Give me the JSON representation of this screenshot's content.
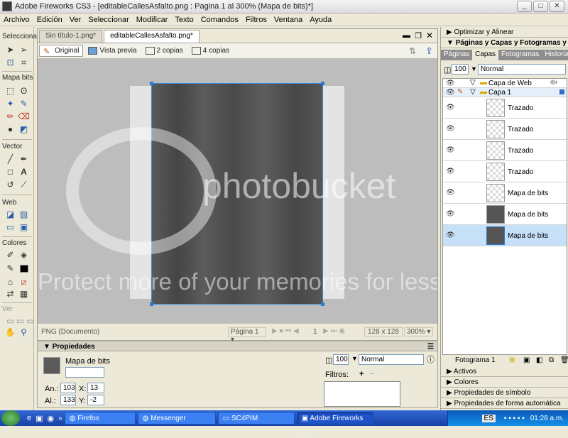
{
  "window": {
    "title": "Adobe Fireworks CS3 - [editableCallesAsfalto.png : Pagina 1 al 300% (Mapa de bits)*]"
  },
  "menu": [
    "Archivo",
    "Edición",
    "Ver",
    "Seleccionar",
    "Modificar",
    "Texto",
    "Comandos",
    "Filtros",
    "Ventana",
    "Ayuda"
  ],
  "tools": {
    "sections": [
      "Seleccionar",
      "Mapa bits",
      "Vector",
      "Web",
      "Colores",
      "Ver"
    ]
  },
  "doc": {
    "tabs": [
      "Sin título-1.png*",
      "editableCallesAsfalto.png*"
    ],
    "views": [
      "Original",
      "Vista previa",
      "2 copias",
      "4 copias"
    ],
    "status": {
      "type": "PNG (Documento)",
      "page": "Página 1",
      "frame": "1",
      "size": "128 x 128",
      "zoom": "300%"
    }
  },
  "properties": {
    "title": "Propiedades",
    "object": "Mapa de bits",
    "name_value": "",
    "w_label": "An.:",
    "w": "103",
    "h_label": "Al.:",
    "h": "133",
    "x_label": "X:",
    "x": "13",
    "y_label": "Y:",
    "y": "-2",
    "opacity": "100",
    "blend": "Normal",
    "filters_label": "Filtros:"
  },
  "rpanel": {
    "optimize": "Optimizar y Alinear",
    "pages_title": "Páginas y Capas y Fotogramas y ...",
    "tabs": [
      "Páginas",
      "Capas",
      "Fotogramas",
      "Historial"
    ],
    "opacity": "100",
    "blend": "Normal",
    "layers": [
      {
        "name": "Capa de Web",
        "type": "folder"
      },
      {
        "name": "Capa 1",
        "type": "folder"
      },
      {
        "name": "Trazado",
        "type": "obj"
      },
      {
        "name": "Trazado",
        "type": "obj"
      },
      {
        "name": "Trazado",
        "type": "obj"
      },
      {
        "name": "Trazado",
        "type": "obj"
      },
      {
        "name": "Mapa de bits",
        "type": "obj"
      },
      {
        "name": "Mapa de bits",
        "type": "obj"
      },
      {
        "name": "Mapa de bits",
        "type": "obj",
        "selected": true
      }
    ],
    "frame": "Fotograma 1",
    "collapsed": [
      "Activos",
      "Colores",
      "Propiedades de símbolo",
      "Propiedades de forma automática"
    ]
  },
  "taskbar": {
    "items": [
      "Firefox",
      "Messenger",
      "SC4PIM",
      "Adobe Fireworks ..."
    ],
    "lang": "ES",
    "time": "01:28 a.m."
  },
  "watermark": {
    "brand": "photobucket",
    "tagline": "Protect more of your memories for less!"
  }
}
